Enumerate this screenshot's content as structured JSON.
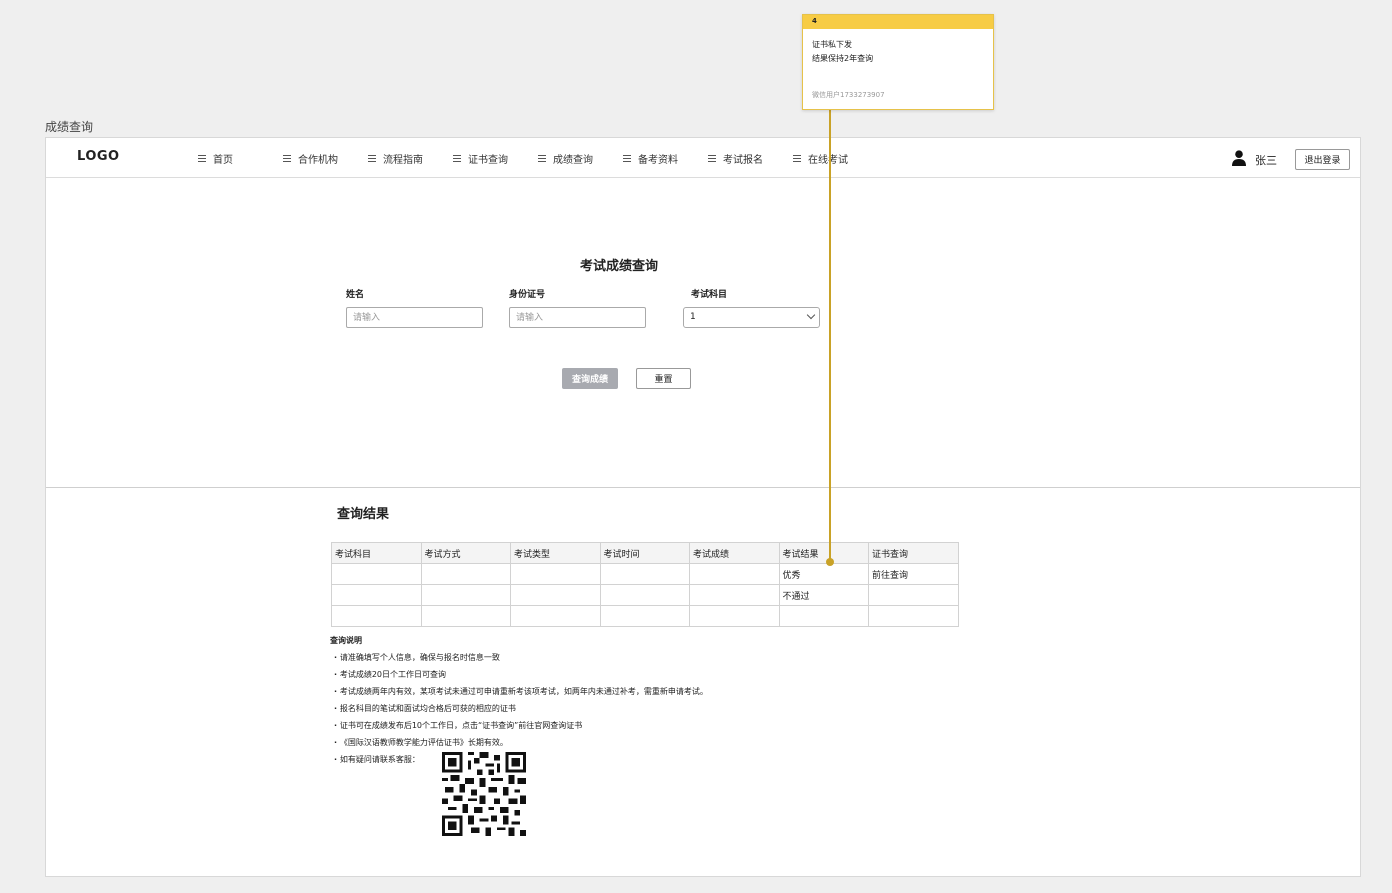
{
  "page_label": "成绩查询",
  "header": {
    "logo": "LOGO",
    "nav": [
      "首页",
      "合作机构",
      "流程指南",
      "证书查询",
      "成绩查询",
      "备考资料",
      "考试报名",
      "在线考试"
    ],
    "user_name": "张三",
    "logout_label": "退出登录"
  },
  "form": {
    "title": "考试成绩查询",
    "name_label": "姓名",
    "name_placeholder": "请输入",
    "id_label": "身份证号",
    "id_placeholder": "请输入",
    "subject_label": "考试科目",
    "subject_value": "1",
    "query_button": "查询成绩",
    "reset_button": "重置"
  },
  "results": {
    "title": "查询结果",
    "columns": [
      "考试科目",
      "考试方式",
      "考试类型",
      "考试时间",
      "考试成绩",
      "考试结果",
      "证书查询"
    ],
    "rows": [
      [
        "",
        "",
        "",
        "",
        "",
        "优秀",
        "前往查询"
      ],
      [
        "",
        "",
        "",
        "",
        "",
        "不通过",
        ""
      ],
      [
        "",
        "",
        "",
        "",
        "",
        "",
        ""
      ]
    ]
  },
  "notes": {
    "title": "查询说明",
    "items": [
      "请准确填写个人信息，确保与报名时信息一致",
      "考试成绩20日个工作日可查询",
      "考试成绩两年内有效，某项考试未通过可申请重新考该项考试，如两年内未通过补考，需重新申请考试。",
      "报名科目的笔试和面试均合格后可获的相应的证书",
      "证书可在成绩发布后10个工作日，点击“证书查询”前往官网查询证书",
      "《国际汉语教师教学能力评估证书》长期有效。",
      "如有疑问请联系客服："
    ]
  },
  "sticky_note": {
    "number": "4",
    "line1": "证书私下发",
    "line2": "结果保持2年查询",
    "author": "微信用户1733273907",
    "accent_color": "#f7cc45"
  }
}
